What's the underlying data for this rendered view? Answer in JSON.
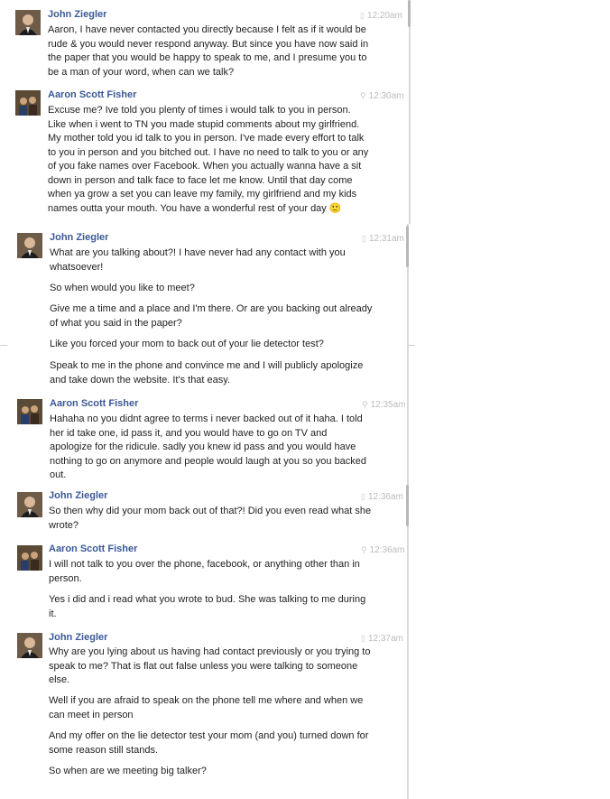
{
  "messages": [
    {
      "sender": "John Ziegler",
      "time": "12:20am",
      "time_icon": "phone-icon",
      "paragraphs": [
        "Aaron, I have never contacted you directly because I felt as if it would be rude & you would never respond anyway. But since you have now said in the paper that you would be happy to speak to me, and I presume you to be a man of your word, when can we talk?"
      ]
    },
    {
      "sender": "Aaron Scott Fisher",
      "time": "12:30am",
      "time_icon": "location-icon",
      "paragraphs": [
        "Excuse me? Ive told you plenty of times i would talk to you in person. Like when i went to TN you made stupid comments about my girlfriend. My mother told you id talk to you in person. I've made every effort to talk to you in person and you bitched out. I have no need to talk to you or any of you fake names over Facebook. When you actually wanna have a sit down in person and talk face to face let me know. Until that day come when ya grow a set you can leave my family, my girlfriend and my kids names outta your mouth. You have a wonderful rest of your day 🙂"
      ]
    },
    {
      "sender": "John Ziegler",
      "time": "12:31am",
      "time_icon": "phone-icon",
      "paragraphs": [
        "What are you talking about?! I have never had any contact with you whatsoever!",
        "So when would you like to meet?",
        "Give me a time and a place and I'm there. Or are you backing out already of what you said in the paper?",
        "Like you forced your mom to back out of your lie detector test?",
        "Speak to me in the phone and convince me and I will publicly apologize and take down the website. It's that easy."
      ]
    },
    {
      "sender": "Aaron Scott Fisher",
      "time": "12:35am",
      "time_icon": "location-icon",
      "paragraphs": [
        "Hahaha no you didnt agree to terms i never backed out of it haha. I told her id take one, id pass it, and you would have to go on TV and apologize for the ridicule. sadly you knew id pass and you would have nothing to go on anymore and people would laugh at you so you backed out."
      ]
    },
    {
      "sender": "John Ziegler",
      "time": "12:36am",
      "time_icon": "phone-icon",
      "paragraphs": [
        "So then why did your mom back out of that?! Did you even read what she wrote?"
      ]
    },
    {
      "sender": "Aaron Scott Fisher",
      "time": "12:36am",
      "time_icon": "location-icon",
      "paragraphs": [
        "I will not talk to you over the phone, facebook, or anything other than in person.",
        "Yes i did and i read what you wrote to bud. She was talking to me during it."
      ]
    },
    {
      "sender": "John Ziegler",
      "time": "12:37am",
      "time_icon": "phone-icon",
      "paragraphs": [
        "Why are you lying about us having had contact previously or you trying to speak to me? That is flat out false unless you were talking to someone else.",
        "Well if you are afraid to speak on the phone tell me where and when we can meet in person",
        "And my offer on the lie detector test your mom (and you) turned down for some reason still stands.",
        "So when are we meeting big talker?"
      ]
    }
  ]
}
